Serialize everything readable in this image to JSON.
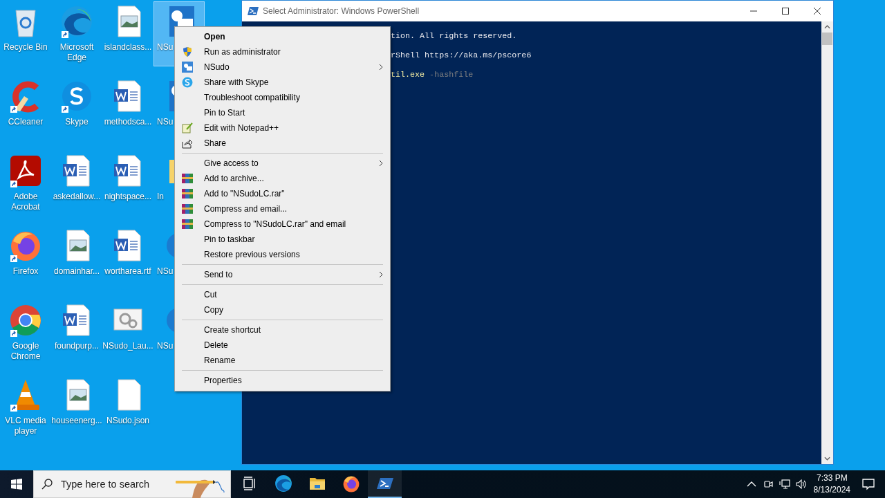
{
  "desktop_icons": [
    {
      "label": "Recycle Bin",
      "kind": "recycle-bin",
      "shortcut": false,
      "selected": false
    },
    {
      "label": "CCleaner",
      "kind": "ccleaner",
      "shortcut": true,
      "selected": false
    },
    {
      "label": "Adobe Acrobat",
      "kind": "acrobat",
      "shortcut": true,
      "selected": false
    },
    {
      "label": "Firefox",
      "kind": "firefox",
      "shortcut": true,
      "selected": false
    },
    {
      "label": "Google Chrome",
      "kind": "chrome",
      "shortcut": true,
      "selected": false
    },
    {
      "label": "VLC media player",
      "kind": "vlc",
      "shortcut": true,
      "selected": false
    },
    {
      "label": "Microsoft Edge",
      "kind": "edge",
      "shortcut": true,
      "selected": false
    },
    {
      "label": "Skype",
      "kind": "skype",
      "shortcut": true,
      "selected": false
    },
    {
      "label": "askedallow...",
      "kind": "word",
      "shortcut": false,
      "selected": false
    },
    {
      "label": "domainhar...",
      "kind": "image",
      "shortcut": false,
      "selected": false
    },
    {
      "label": "foundpurp...",
      "kind": "word",
      "shortcut": false,
      "selected": false
    },
    {
      "label": "houseenerg...",
      "kind": "image",
      "shortcut": false,
      "selected": false
    },
    {
      "label": "islandclass...",
      "kind": "image",
      "shortcut": false,
      "selected": false
    },
    {
      "label": "methodsca...",
      "kind": "word",
      "shortcut": false,
      "selected": false
    },
    {
      "label": "nightspace...",
      "kind": "word",
      "shortcut": false,
      "selected": false
    },
    {
      "label": "wortharea.rtf",
      "kind": "word",
      "shortcut": false,
      "selected": false
    },
    {
      "label": "NSudo_Lau...",
      "kind": "gears",
      "shortcut": false,
      "selected": false
    },
    {
      "label": "NSudo.json",
      "kind": "blank",
      "shortcut": false,
      "selected": false
    },
    {
      "label": "NSu",
      "kind": "nsudo",
      "shortcut": false,
      "selected": true
    },
    {
      "label": "NSu",
      "kind": "nsudo",
      "shortcut": false,
      "selected": false
    },
    {
      "label": "In",
      "kind": "folder",
      "shortcut": false,
      "selected": false
    },
    {
      "label": "NSu",
      "kind": "edge-part",
      "shortcut": false,
      "selected": false
    },
    {
      "label": "NSu",
      "kind": "edge-part",
      "shortcut": false,
      "selected": false
    }
  ],
  "window": {
    "title": "Select Administrator: Windows PowerShell",
    "console_lines": [
      {
        "parts": [
          {
            "text": "tion. All rights reserved.",
            "kind": "output"
          }
        ]
      },
      {
        "parts": [
          {
            "text": "rShell https://aka.ms/pscore6",
            "kind": "output"
          }
        ]
      },
      {
        "parts": [
          {
            "text": "til.exe",
            "kind": "command"
          },
          {
            "text": " -hashfile",
            "kind": "parameter"
          }
        ]
      }
    ]
  },
  "context_menu": {
    "groups": [
      [
        {
          "label": "Open",
          "kind": "plain",
          "default": true,
          "submenu": false
        },
        {
          "label": "Run as administrator",
          "kind": "shield",
          "default": false,
          "submenu": false
        },
        {
          "label": "NSudo",
          "kind": "nsudo",
          "default": false,
          "submenu": true
        },
        {
          "label": "Share with Skype",
          "kind": "skype",
          "default": false,
          "submenu": false
        },
        {
          "label": "Troubleshoot compatibility",
          "kind": "plain",
          "default": false,
          "submenu": false
        },
        {
          "label": "Pin to Start",
          "kind": "plain",
          "default": false,
          "submenu": false
        },
        {
          "label": "Edit with Notepad++",
          "kind": "notepad",
          "default": false,
          "submenu": false
        },
        {
          "label": "Share",
          "kind": "share",
          "default": false,
          "submenu": false
        }
      ],
      [
        {
          "label": "Give access to",
          "kind": "plain",
          "default": false,
          "submenu": true
        },
        {
          "label": "Add to archive...",
          "kind": "archive",
          "default": false,
          "submenu": false
        },
        {
          "label": "Add to \"NSudoLC.rar\"",
          "kind": "archive",
          "default": false,
          "submenu": false
        },
        {
          "label": "Compress and email...",
          "kind": "archive",
          "default": false,
          "submenu": false
        },
        {
          "label": "Compress to \"NSudoLC.rar\" and email",
          "kind": "archive",
          "default": false,
          "submenu": false
        },
        {
          "label": "Pin to taskbar",
          "kind": "plain",
          "default": false,
          "submenu": false
        },
        {
          "label": "Restore previous versions",
          "kind": "plain",
          "default": false,
          "submenu": false
        }
      ],
      [
        {
          "label": "Send to",
          "kind": "plain",
          "default": false,
          "submenu": true
        }
      ],
      [
        {
          "label": "Cut",
          "kind": "plain",
          "default": false,
          "submenu": false
        },
        {
          "label": "Copy",
          "kind": "plain",
          "default": false,
          "submenu": false
        }
      ],
      [
        {
          "label": "Create shortcut",
          "kind": "plain",
          "default": false,
          "submenu": false
        },
        {
          "label": "Delete",
          "kind": "plain",
          "default": false,
          "submenu": false
        },
        {
          "label": "Rename",
          "kind": "plain",
          "default": false,
          "submenu": false
        }
      ],
      [
        {
          "label": "Properties",
          "kind": "plain",
          "default": false,
          "submenu": false
        }
      ]
    ]
  },
  "taskbar": {
    "search": {
      "placeholder": "Type here to search"
    },
    "apps": [
      {
        "kind": "task-view",
        "active": false
      },
      {
        "kind": "edge",
        "active": false
      },
      {
        "kind": "explorer",
        "active": false
      },
      {
        "kind": "firefox",
        "active": false
      },
      {
        "kind": "powershell",
        "active": true
      }
    ],
    "clock": {
      "time": "7:33 PM",
      "date": "8/13/2024"
    }
  }
}
